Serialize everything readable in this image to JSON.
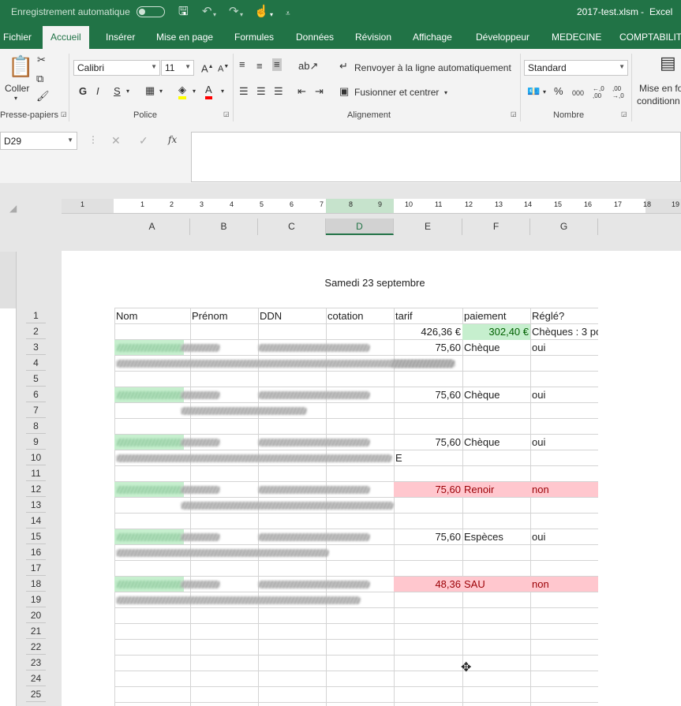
{
  "titlebar": {
    "autosave_label": "Enregistrement automatique",
    "filename": "2017-test.xlsm",
    "separator": "-",
    "app_name": "Excel"
  },
  "tabs": [
    "Fichier",
    "Accueil",
    "Insérer",
    "Mise en page",
    "Formules",
    "Données",
    "Révision",
    "Affichage",
    "Développeur",
    "MEDECINE",
    "COMPTABILITE"
  ],
  "active_tab": "Accueil",
  "ribbon": {
    "clipboard": {
      "paste_label": "Coller",
      "group_label": "Presse-papiers"
    },
    "font": {
      "font_name": "Calibri",
      "font_size": "11",
      "bold": "G",
      "italic": "I",
      "underline": "S",
      "group_label": "Police"
    },
    "alignment": {
      "wrap_label": "Renvoyer à la ligne automatiquement",
      "merge_label": "Fusionner et centrer",
      "group_label": "Alignement"
    },
    "number": {
      "format": "Standard",
      "percent": "%",
      "thousands": "000",
      "dec_inc": "←,0 ,00",
      "dec_dec": ",00 →,0",
      "group_label": "Nombre"
    },
    "styles": {
      "cond_format_line1": "Mise en fo",
      "cond_format_line2": "conditionn"
    }
  },
  "formula_bar": {
    "name_box": "D29",
    "fx": "fx",
    "cancel": "✕",
    "enter": "✓",
    "value": ""
  },
  "ruler_numbers": [
    "1",
    "1",
    "2",
    "3",
    "4",
    "5",
    "6",
    "7",
    "8",
    "9",
    "10",
    "11",
    "12",
    "13",
    "14",
    "15",
    "16",
    "17",
    "18",
    "19"
  ],
  "columns": [
    "A",
    "B",
    "C",
    "D",
    "E",
    "F",
    "G"
  ],
  "selected_column": "D",
  "rows": [
    "1",
    "2",
    "3",
    "4",
    "5",
    "6",
    "7",
    "8",
    "9",
    "10",
    "11",
    "12",
    "13",
    "14",
    "15",
    "16",
    "17",
    "18",
    "19",
    "20",
    "21",
    "22",
    "23",
    "24",
    "25"
  ],
  "page_title": "Samedi 23 septembre",
  "headers": [
    "Nom",
    "Prénom",
    "DDN",
    "cotation",
    "tarif",
    "paiement",
    "Réglé?"
  ],
  "row2": {
    "tarif": "426,36 €",
    "paiement": "302,40 €",
    "regle": "Chèques : 3 po"
  },
  "entries": [
    {
      "row": 3,
      "tarif": "75,60",
      "paiement": "Chèque",
      "regle": "oui",
      "status": "paid"
    },
    {
      "row": 6,
      "tarif": "75,60",
      "paiement": "Chèque",
      "regle": "oui",
      "status": "paid"
    },
    {
      "row": 9,
      "tarif": "75,60",
      "paiement": "Chèque",
      "regle": "oui",
      "status": "paid"
    },
    {
      "row": 12,
      "tarif": "75,60",
      "paiement": "Renoir",
      "regle": "non",
      "status": "unpaid"
    },
    {
      "row": 15,
      "tarif": "75,60",
      "paiement": "Espèces",
      "regle": "oui",
      "status": "paid"
    },
    {
      "row": 18,
      "tarif": "48,36",
      "paiement": "SAU",
      "regle": "non",
      "status": "unpaid"
    }
  ],
  "row10_suffix": "E",
  "colors": {
    "brand": "#217346",
    "unpaid_fill": "#ffc7ce",
    "unpaid_text": "#9c0006",
    "paid_fill": "#c6efce",
    "paid_text": "#006100"
  }
}
